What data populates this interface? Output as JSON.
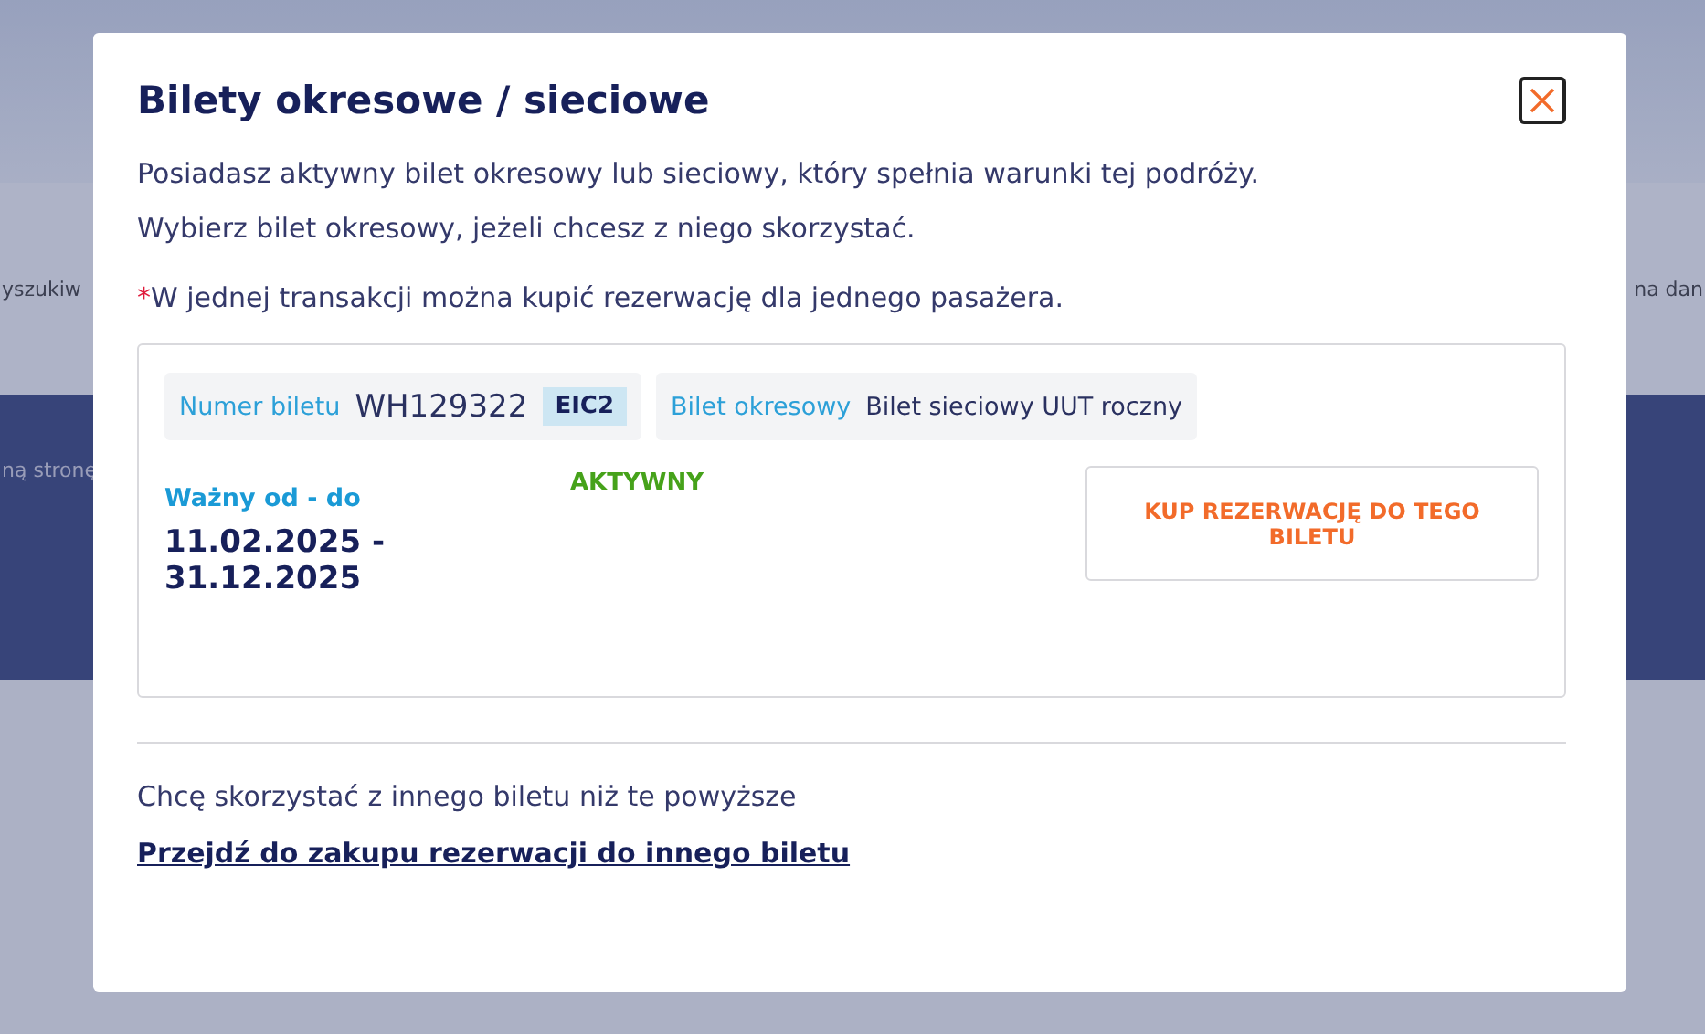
{
  "background": {
    "left_texts": [
      "yszukiw",
      "ną stronę"
    ],
    "right_text": "na dan"
  },
  "dialog": {
    "title": "Bilety okresowe / sieciowe",
    "paragraphs": [
      "Posiadasz aktywny bilet okresowy lub sieciowy, który spełnia warunki tej podróży.",
      "Wybierz bilet okresowy, jeżeli chcesz z niego skorzystać."
    ],
    "note": {
      "mark": "*",
      "text": "W jednej transakcji można kupić rezerwację dla jednego pasażera."
    },
    "ticket": {
      "number_label": "Numer biletu",
      "number": "WH129322",
      "badge": "EIC2",
      "type_label": "Bilet okresowy",
      "type": "Bilet sieciowy UUT roczny",
      "validity_label": "Ważny od - do",
      "validity": "11.02.2025 - 31.12.2025",
      "status": "AKTYWNY",
      "button": "KUP REZERWACJĘ DO TEGO BILETU"
    },
    "other_text": "Chcę skorzystać z innego biletu niż te powyższe",
    "other_link": "Przejdź do zakupu rezerwacji do innego biletu"
  }
}
